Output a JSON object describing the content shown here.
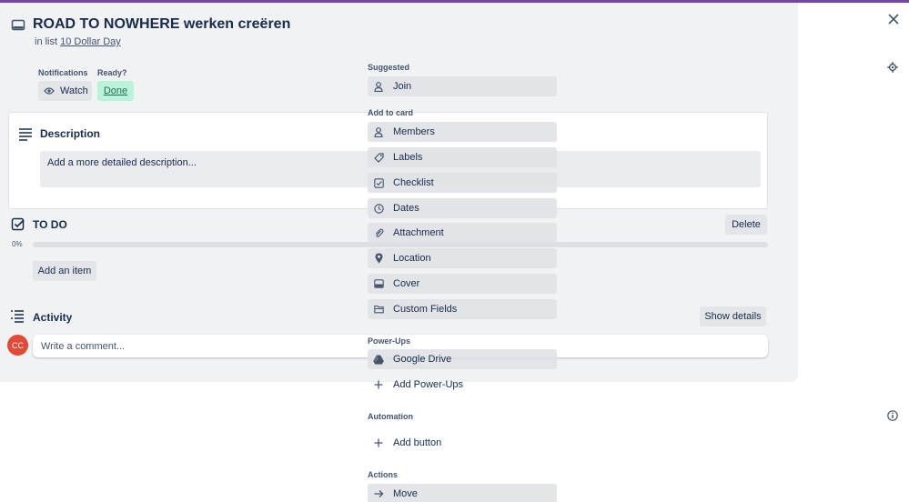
{
  "card": {
    "title": "ROAD TO NOWHERE werken creëren",
    "in_list_prefix": "in list",
    "list_name": "10 Dollar Day"
  },
  "notifications": {
    "label": "Notifications",
    "watch_label": "Watch"
  },
  "ready": {
    "label": "Ready?",
    "done_label": "Done"
  },
  "description": {
    "heading": "Description",
    "placeholder": "Add a more detailed description..."
  },
  "checklist": {
    "title": "TO DO",
    "delete_label": "Delete",
    "progress_text": "0%",
    "progress": 0,
    "add_item_label": "Add an item"
  },
  "activity": {
    "heading": "Activity",
    "show_details_label": "Show details",
    "avatar_initials": "CC",
    "comment_placeholder": "Write a comment..."
  },
  "sidebar": {
    "suggested": {
      "heading": "Suggested",
      "join_label": "Join"
    },
    "add_to_card": {
      "heading": "Add to card",
      "items": [
        {
          "label": "Members",
          "icon": "person-icon"
        },
        {
          "label": "Labels",
          "icon": "label-icon"
        },
        {
          "label": "Checklist",
          "icon": "checklist-icon"
        },
        {
          "label": "Dates",
          "icon": "clock-icon"
        },
        {
          "label": "Attachment",
          "icon": "paperclip-icon"
        },
        {
          "label": "Location",
          "icon": "location-pin-icon"
        },
        {
          "label": "Cover",
          "icon": "cover-icon"
        },
        {
          "label": "Custom Fields",
          "icon": "folder-icon"
        }
      ]
    },
    "power_ups": {
      "heading": "Power-Ups",
      "google_drive_label": "Google Drive",
      "add_label": "Add Power-Ups"
    },
    "automation": {
      "heading": "Automation",
      "add_button_label": "Add button"
    },
    "actions": {
      "heading": "Actions",
      "move_label": "Move"
    }
  },
  "colors": {
    "top_bar": "#6e46ae",
    "done_bg": "#baf3db",
    "avatar_bg": "#e34935",
    "panel_bg": "#f1f2f4"
  }
}
